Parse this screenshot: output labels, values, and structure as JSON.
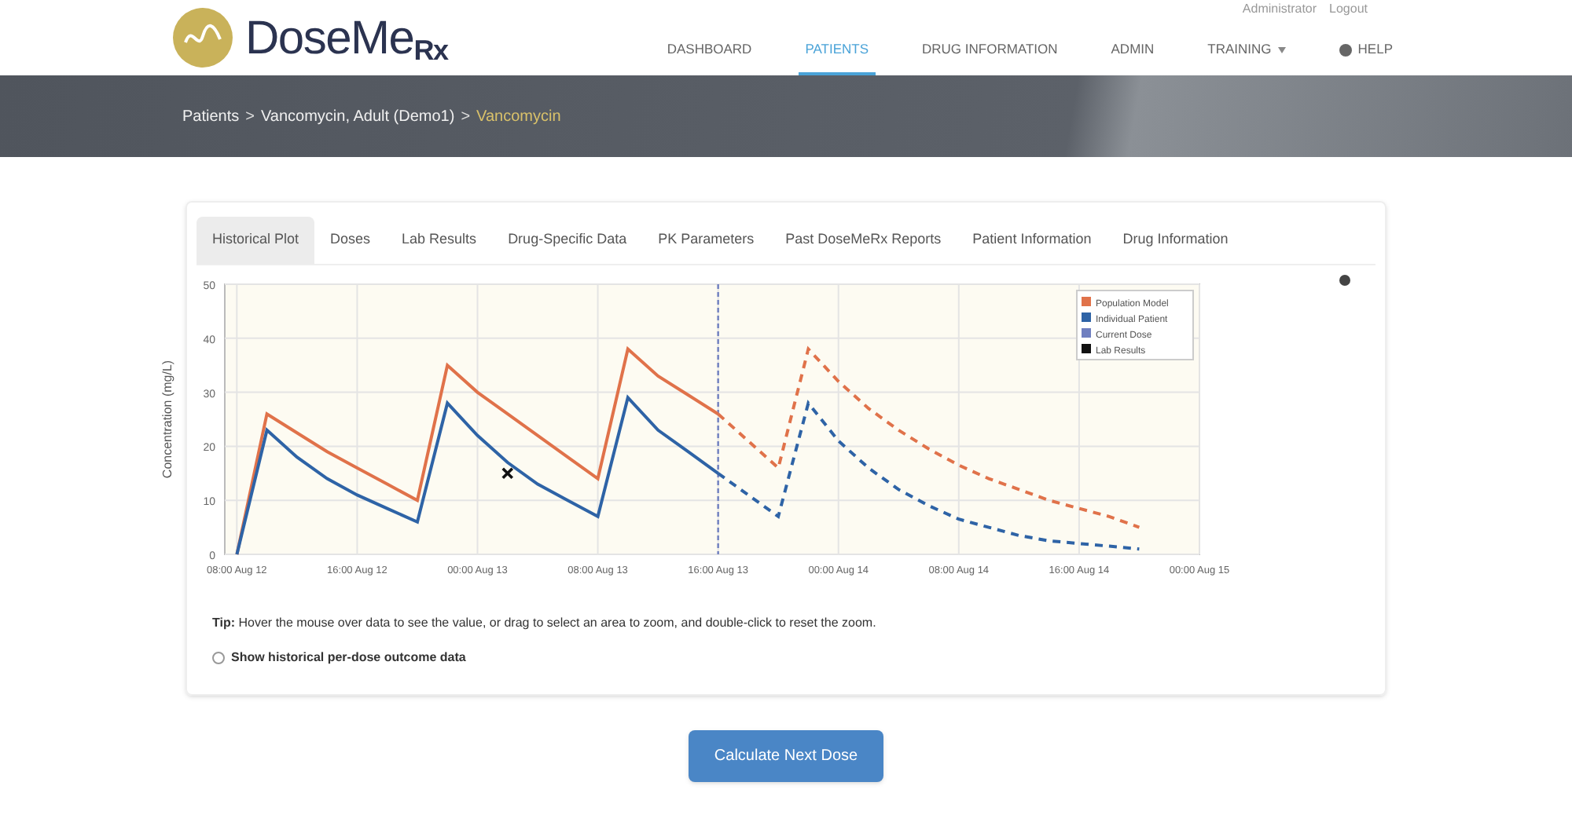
{
  "header": {
    "logo": {
      "name": "DoseMe",
      "suffix": "Rx"
    },
    "user_links": [
      "Administrator",
      "Logout"
    ],
    "nav": [
      {
        "label": "DASHBOARD",
        "selected": false,
        "kind": "link"
      },
      {
        "label": "PATIENTS",
        "selected": true,
        "kind": "link"
      },
      {
        "label": "DRUG INFORMATION",
        "selected": false,
        "kind": "link"
      },
      {
        "label": "ADMIN",
        "selected": false,
        "kind": "link"
      },
      {
        "label": "TRAINING",
        "selected": false,
        "kind": "dropdown"
      },
      {
        "label": "HELP",
        "selected": false,
        "kind": "help"
      }
    ]
  },
  "breadcrumb": {
    "separator": ">",
    "items": [
      {
        "label": "Patients",
        "selected": false
      },
      {
        "label": "Vancomycin, Adult (Demo1)",
        "selected": false
      },
      {
        "label": "Vancomycin",
        "selected": true
      }
    ]
  },
  "tabs": [
    {
      "label": "Historical Plot",
      "selected": true
    },
    {
      "label": "Doses",
      "selected": false
    },
    {
      "label": "Lab Results",
      "selected": false
    },
    {
      "label": "Drug-Specific Data",
      "selected": false
    },
    {
      "label": "PK Parameters",
      "selected": false
    },
    {
      "label": "Past DoseMeRx Reports",
      "selected": false
    },
    {
      "label": "Patient Information",
      "selected": false
    },
    {
      "label": "Drug Information",
      "selected": false
    }
  ],
  "chart": {
    "legend_entries": [
      {
        "label": "Current Dose",
        "color": "#6f7fc0"
      }
    ],
    "chart_data": {
      "type": "line",
      "ylabel": "Concentration (mg/L)",
      "categories": [
        "08:00 Aug 12",
        null,
        null,
        null,
        "16:00 Aug 12",
        null,
        null,
        null,
        "00:00 Aug 13",
        null,
        null,
        null,
        "08:00 Aug 13",
        null,
        null,
        null,
        "16:00 Aug 13",
        null,
        null,
        null,
        "00:00 Aug 14",
        null,
        null,
        null,
        "08:00 Aug 14",
        null,
        null,
        null,
        "16:00 Aug 14",
        null,
        null,
        null,
        "00:00 Aug 15"
      ],
      "ylim": [
        0,
        50
      ],
      "yticks": [
        0,
        10,
        20,
        30,
        40,
        50
      ],
      "grid": true,
      "legend": true,
      "series": [
        {
          "name": "Population Model",
          "color": "#e0724a",
          "values": [
            0,
            26,
            22.5,
            19,
            16,
            13,
            10,
            35,
            30,
            26,
            22,
            18,
            14,
            38,
            33,
            29.5,
            26,
            21,
            16,
            38,
            32,
            27,
            23,
            19.5,
            16.5,
            14,
            12,
            10,
            8.5,
            7,
            5,
            null,
            null
          ]
        },
        {
          "name": "Individual Patient",
          "color": "#2e63a6",
          "values": [
            0,
            23,
            18,
            14,
            11,
            8.5,
            6,
            28,
            22,
            17,
            13,
            10,
            7,
            29,
            23,
            19,
            15,
            11,
            7,
            28,
            21,
            16,
            12,
            9,
            6.5,
            5,
            3.5,
            2.5,
            2,
            1.5,
            1,
            null,
            null
          ]
        },
        {
          "name": "Lab Results",
          "color": "#111111",
          "marker": "x",
          "values": [
            null,
            null,
            null,
            null,
            null,
            null,
            null,
            null,
            null,
            15,
            null,
            null,
            null,
            null,
            null,
            null,
            null,
            null,
            null,
            null,
            null,
            null,
            null,
            null,
            null,
            null,
            null,
            null,
            null,
            null,
            null,
            null,
            null
          ]
        }
      ],
      "ref_lines": [
        {
          "axis": "x",
          "value": "16:00 Aug 13",
          "color": "#6f7fc0"
        }
      ]
    }
  },
  "tip": {
    "label": "Tip:",
    "text": "Hover the mouse over data to see the value, or drag to select an area to zoom, and double-click to reset the zoom."
  },
  "option": {
    "label": "Show historical per-dose outcome data",
    "checked": false
  },
  "action": {
    "label": "Calculate Next Dose"
  }
}
